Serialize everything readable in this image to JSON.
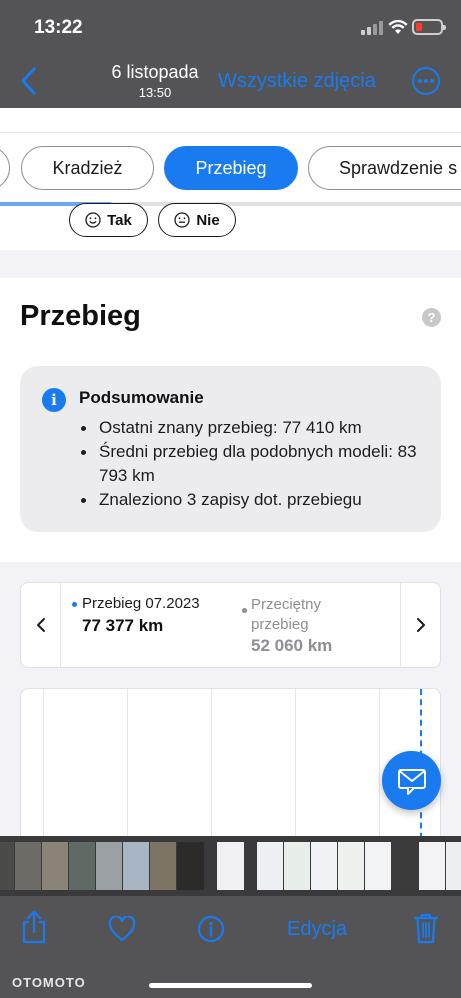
{
  "status_bar": {
    "time": "13:22"
  },
  "nav": {
    "date": "6 listopada",
    "time": "13:50",
    "all_photos": "Wszystkie zdjęcia",
    "back_icon": "chevron-left-icon",
    "more_icon": "ellipsis-circle-icon"
  },
  "tabs": [
    {
      "label": "Kradzież",
      "active": false
    },
    {
      "label": "Przebieg",
      "active": true
    },
    {
      "label": "Sprawdzenie s",
      "active": false
    }
  ],
  "scroll_progress": 0.24,
  "feedback": {
    "yes": "Tak",
    "no": "Nie"
  },
  "section": {
    "title": "Przebieg",
    "help": "?"
  },
  "summary": {
    "title": "Podsumowanie",
    "items": [
      "Ostatni znany przebieg: 77 410 km",
      "Średni przebieg dla podobnych modeli: 83 793 km",
      "Znaleziono 3 zapisy dot. przebiegu"
    ]
  },
  "stats": {
    "current_label": "Przebieg 07.2023",
    "current_value": "77 377 km",
    "average_label": "Przeciętny przebieg",
    "average_value": "52 060 km"
  },
  "toolbar": {
    "edit": "Edycja",
    "share_icon": "share-icon",
    "favorite_icon": "heart-icon",
    "info_icon": "info-icon",
    "delete_icon": "trash-icon"
  },
  "watermark": "OTOMOTO",
  "colors": {
    "accent": "#1a7bf0",
    "bars": "#545456"
  }
}
